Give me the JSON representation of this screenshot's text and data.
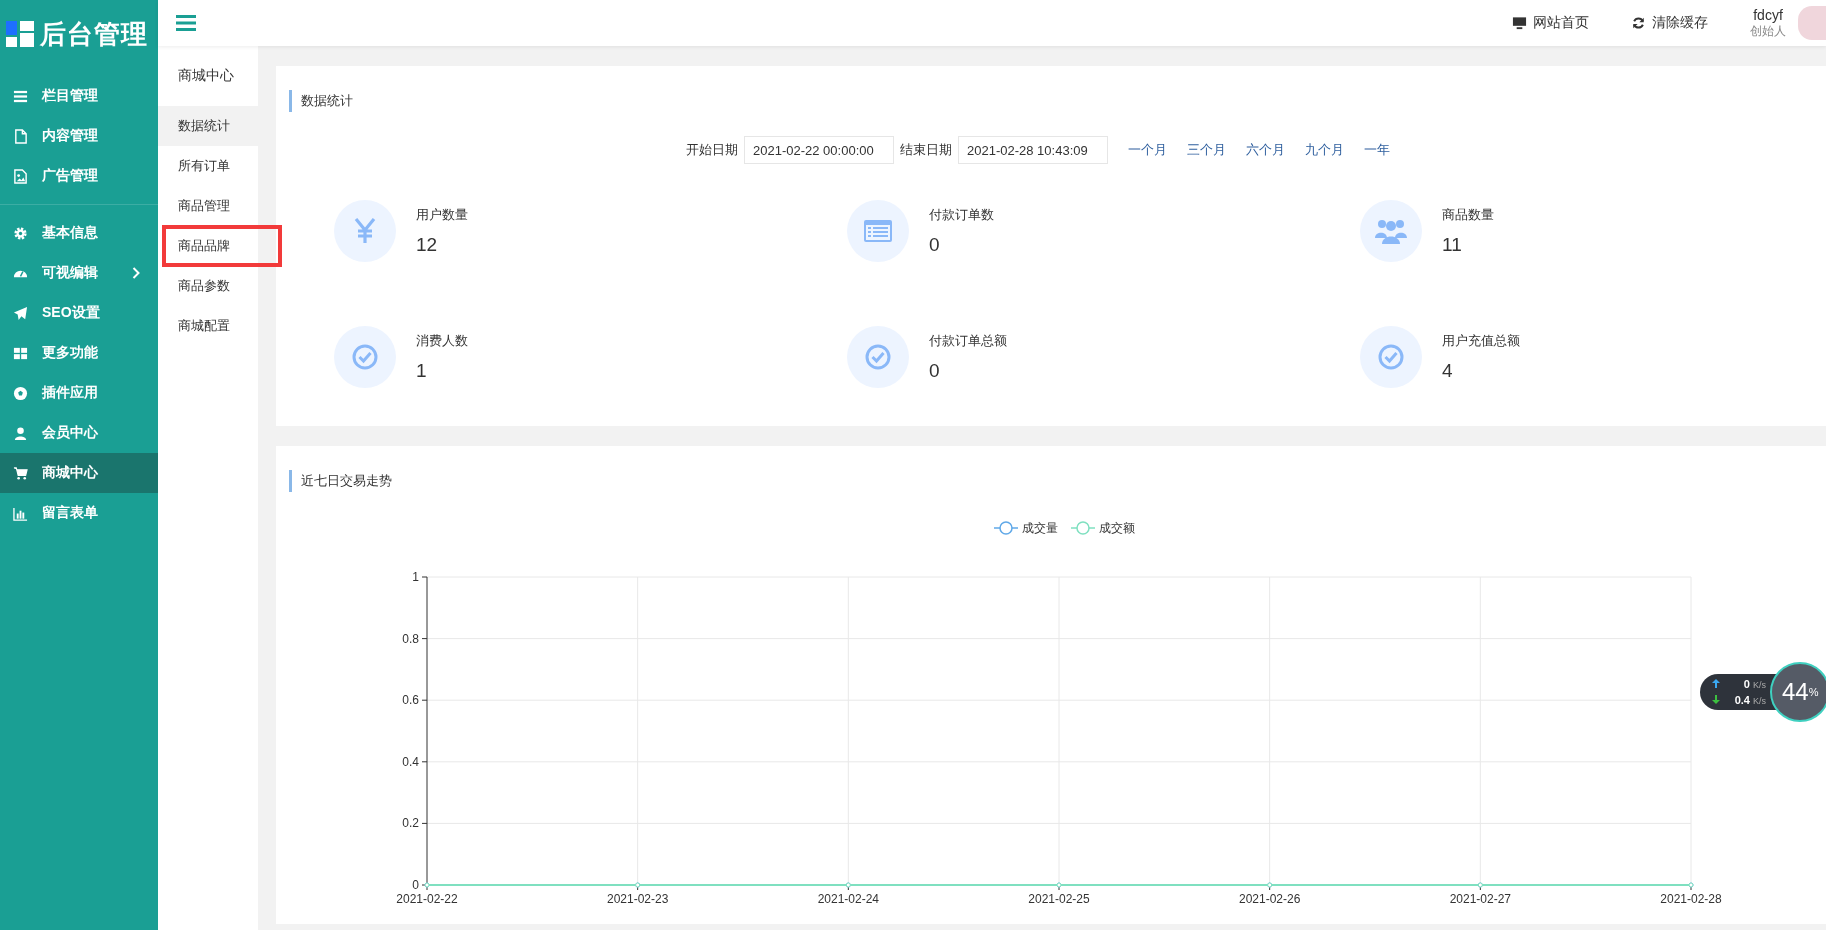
{
  "logo": {
    "text": "后台管理"
  },
  "sidebar": {
    "groups": [
      [
        {
          "label": "栏目管理",
          "selected": false,
          "has_submenu": false
        },
        {
          "label": "内容管理",
          "selected": false,
          "has_submenu": false
        },
        {
          "label": "广告管理",
          "selected": false,
          "has_submenu": false
        }
      ],
      [
        {
          "label": "基本信息",
          "selected": false,
          "has_submenu": false
        },
        {
          "label": "可视编辑",
          "selected": false,
          "has_submenu": true
        },
        {
          "label": "SEO设置",
          "selected": false,
          "has_submenu": false
        },
        {
          "label": "更多功能",
          "selected": false,
          "has_submenu": false
        },
        {
          "label": "插件应用",
          "selected": false,
          "has_submenu": false
        },
        {
          "label": "会员中心",
          "selected": false,
          "has_submenu": false
        },
        {
          "label": "商城中心",
          "selected": true,
          "has_submenu": false
        },
        {
          "label": "留言表单",
          "selected": false,
          "has_submenu": false
        }
      ]
    ]
  },
  "subnav": {
    "title": "商城中心",
    "items": [
      {
        "label": "数据统计",
        "selected": true,
        "highlighted": false
      },
      {
        "label": "所有订单",
        "selected": false,
        "highlighted": false
      },
      {
        "label": "商品管理",
        "selected": false,
        "highlighted": false
      },
      {
        "label": "商品品牌",
        "selected": false,
        "highlighted": true
      },
      {
        "label": "商品参数",
        "selected": false,
        "highlighted": false
      },
      {
        "label": "商城配置",
        "selected": false,
        "highlighted": false
      }
    ]
  },
  "header": {
    "links": [
      "网站首页",
      "清除缓存"
    ],
    "user": {
      "name": "fdcyf",
      "role": "创始人"
    }
  },
  "stats_panel": {
    "title": "数据统计",
    "start_label": "开始日期",
    "start_value": "2021-02-22 00:00:00",
    "end_label": "结束日期",
    "end_value": "2021-02-28 10:43:09",
    "ranges": [
      "一个月",
      "三个月",
      "六个月",
      "九个月",
      "一年"
    ],
    "stats": [
      {
        "label": "用户数量",
        "value": "12"
      },
      {
        "label": "付款订单数",
        "value": "0"
      },
      {
        "label": "商品数量",
        "value": "11"
      },
      {
        "label": "消费人数",
        "value": "1"
      },
      {
        "label": "付款订单总额",
        "value": "0"
      },
      {
        "label": "用户充值总额",
        "value": "4"
      }
    ]
  },
  "trend_panel": {
    "title": "近七日交易走势",
    "chart_data": {
      "type": "line",
      "categories": [
        "2021-02-22",
        "2021-02-23",
        "2021-02-24",
        "2021-02-25",
        "2021-02-26",
        "2021-02-27",
        "2021-02-28"
      ],
      "series": [
        {
          "name": "成交量",
          "color": "#5fa8e8",
          "marker": "circle",
          "values": [
            0,
            0,
            0,
            0,
            0,
            0,
            0
          ]
        },
        {
          "name": "成交额",
          "color": "#7fe0c0",
          "marker": "circle",
          "values": [
            0,
            0,
            0,
            0,
            0,
            0,
            0
          ]
        }
      ],
      "grid": true,
      "legend": true,
      "ylim": [
        0,
        1
      ],
      "yticks": [
        0,
        0.2,
        0.4,
        0.6,
        0.8,
        1
      ]
    }
  },
  "speed_widget": {
    "upload": "0",
    "upload_unit": "K/s",
    "download": "0.4",
    "download_unit": "K/s",
    "percent": "44",
    "percent_sign": "%"
  }
}
